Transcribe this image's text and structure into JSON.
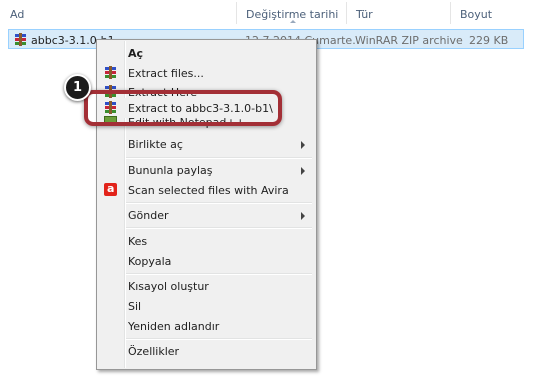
{
  "columns": {
    "name": "Ad",
    "modified": "Değiştirme tarihi",
    "type": "Tür",
    "size": "Boyut"
  },
  "file": {
    "name": "abbc3-3.1.0-b1",
    "date": "12.7.2014 Cumarte...",
    "type": "WinRAR ZIP archive",
    "size": "229 KB",
    "icon": "winrar-archive-icon"
  },
  "menu": {
    "open": "Aç",
    "extract_files": "Extract files...",
    "extract_here": "Extract Here",
    "extract_to": "Extract to abbc3-3.1.0-b1\\",
    "edit_notepad": "Edit with Notepad++",
    "open_with": "Birlikte aç",
    "share_with": "Bununla paylaş",
    "scan_avira": "Scan selected files with Avira",
    "send_to": "Gönder",
    "cut": "Kes",
    "copy": "Kopyala",
    "create_shortcut": "Kısayol oluştur",
    "delete": "Sil",
    "rename": "Yeniden adlandır",
    "properties": "Özellikler"
  },
  "callout": {
    "step": "1",
    "color": "#a32f36"
  }
}
